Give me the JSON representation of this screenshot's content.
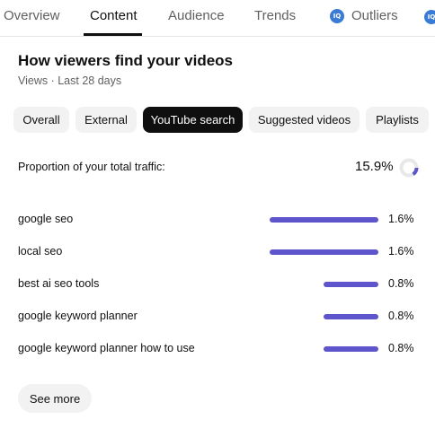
{
  "tabs": {
    "overview": "Overview",
    "content": "Content",
    "audience": "Audience",
    "trends": "Trends",
    "outliers": "Outliers",
    "outliers_badge": "IQ"
  },
  "card": {
    "title": "How viewers find your videos",
    "subtitle": "Views · Last 28 days"
  },
  "chips": [
    "Overall",
    "External",
    "YouTube search",
    "Suggested videos",
    "Playlists"
  ],
  "selected_chip": "YouTube search",
  "proportion": {
    "label": "Proportion of your total traffic:",
    "value": "15.9%",
    "fraction": 0.159
  },
  "terms": [
    {
      "label": "google seo",
      "value": "1.6%",
      "share": 1.6
    },
    {
      "label": "local seo",
      "value": "1.6%",
      "share": 1.6
    },
    {
      "label": "best ai seo tools",
      "value": "0.8%",
      "share": 0.8
    },
    {
      "label": "google keyword planner",
      "value": "0.8%",
      "share": 0.8
    },
    {
      "label": "google keyword planner how to use",
      "value": "0.8%",
      "share": 0.8
    }
  ],
  "see_more_label": "See more",
  "colors": {
    "bar": "#5e55cc",
    "donut_track": "#e8e8e8",
    "selected_chip": "#0f0f0f"
  }
}
